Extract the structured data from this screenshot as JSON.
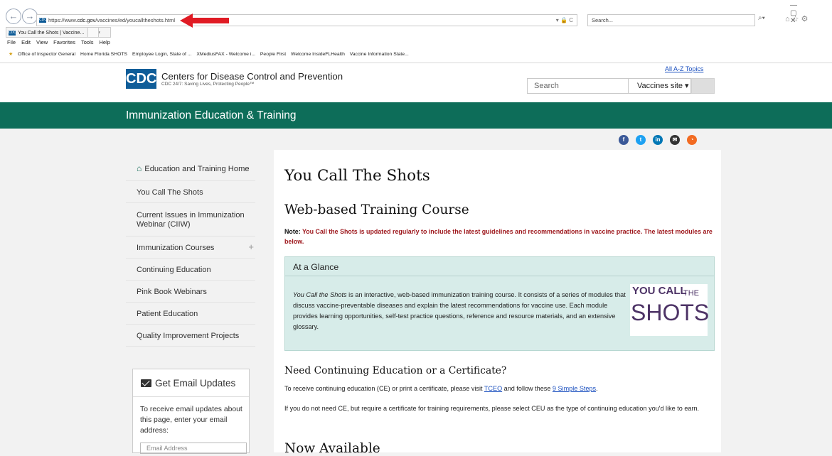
{
  "browser": {
    "url_prefix": "https://www.",
    "url_host": "cdc.gov",
    "url_path": "/vaccines/ed/youcalltheshots.html",
    "search_placeholder": "Search...",
    "tab_title": "You Call the Shots | Vaccine...",
    "menu_items": [
      "File",
      "Edit",
      "View",
      "Favorites",
      "Tools",
      "Help"
    ],
    "favorites": [
      "Office of Inspector General",
      "Home Florida SHOTS",
      "Employee Login, State of ...",
      "XMediusFAX - Welcome i...",
      "People First",
      "Welcome InsideFLHealth",
      "Vaccine Information State..."
    ]
  },
  "header": {
    "logo": "CDC",
    "org_name": "Centers for Disease Control and Prevention",
    "tagline": "CDC 24/7: Saving Lives, Protecting People™",
    "az_link": "All A-Z Topics",
    "search_placeholder": "Search",
    "scope_label": "Vaccines site ▾"
  },
  "section": {
    "title": "Immunization Education & Training"
  },
  "share_icons": [
    {
      "name": "facebook-icon",
      "glyph": "f",
      "color": "#3b5998"
    },
    {
      "name": "twitter-icon",
      "glyph": "t",
      "color": "#1da1f2"
    },
    {
      "name": "linkedin-icon",
      "glyph": "in",
      "color": "#0077b5"
    },
    {
      "name": "email-icon",
      "glyph": "✉",
      "color": "#333333"
    },
    {
      "name": "syndicate-icon",
      "glyph": "◔",
      "color": "#f26b22"
    }
  ],
  "sidebar": {
    "home_label": "Education and Training Home",
    "items": [
      "You Call The Shots",
      "Current Issues in Immunization Webinar (CIIW)",
      "Immunization Courses",
      "Continuing Education",
      "Pink Book Webinars",
      "Patient Education",
      "Quality Improvement Projects"
    ]
  },
  "email_updates": {
    "title": "Get Email Updates",
    "description": "To receive email updates about this page, enter your email address:",
    "placeholder": "Email Address"
  },
  "main": {
    "title": "You Call The Shots",
    "subtitle": "Web-based Training Course",
    "note_label": "Note: ",
    "note_text": "You Call the Shots is updated regularly to include the latest guidelines and recommendations in vaccine practice. The latest modules are below.",
    "glance_title": "At a Glance",
    "glance_italic": "You Call the Shots",
    "glance_text": " is an interactive, web-based immunization training course. It consists of a series of modules that discuss vaccine-preventable diseases and explain the latest recommendations for vaccine use. Each module provides learning opportunities, self-test practice questions, reference and resource materials, and an extensive glossary.",
    "logo_top": "YOU CALL",
    "logo_the": "THE",
    "logo_bottom": "SHOTS",
    "ce_heading": "Need Continuing Education or a Certificate?",
    "ce_text_prefix": "To receive continuing education (CE) or print a certificate, please visit ",
    "ce_link1": "TCEO",
    "ce_text_middle": " and follow these ",
    "ce_link2": "9 Simple Steps",
    "ce_text_suffix": ".",
    "ceu_text": "If you do not need CE, but require a certificate for training requirements, please select CEU as the type of continuing education you'd like to earn.",
    "now_heading": "Now Available"
  },
  "colors": {
    "brand_green": "#0d6d59",
    "cdc_blue": "#0f5d99",
    "note_red": "#9d161b",
    "glance_bg": "#d7ece9",
    "arrow_red": "#e01b24"
  }
}
